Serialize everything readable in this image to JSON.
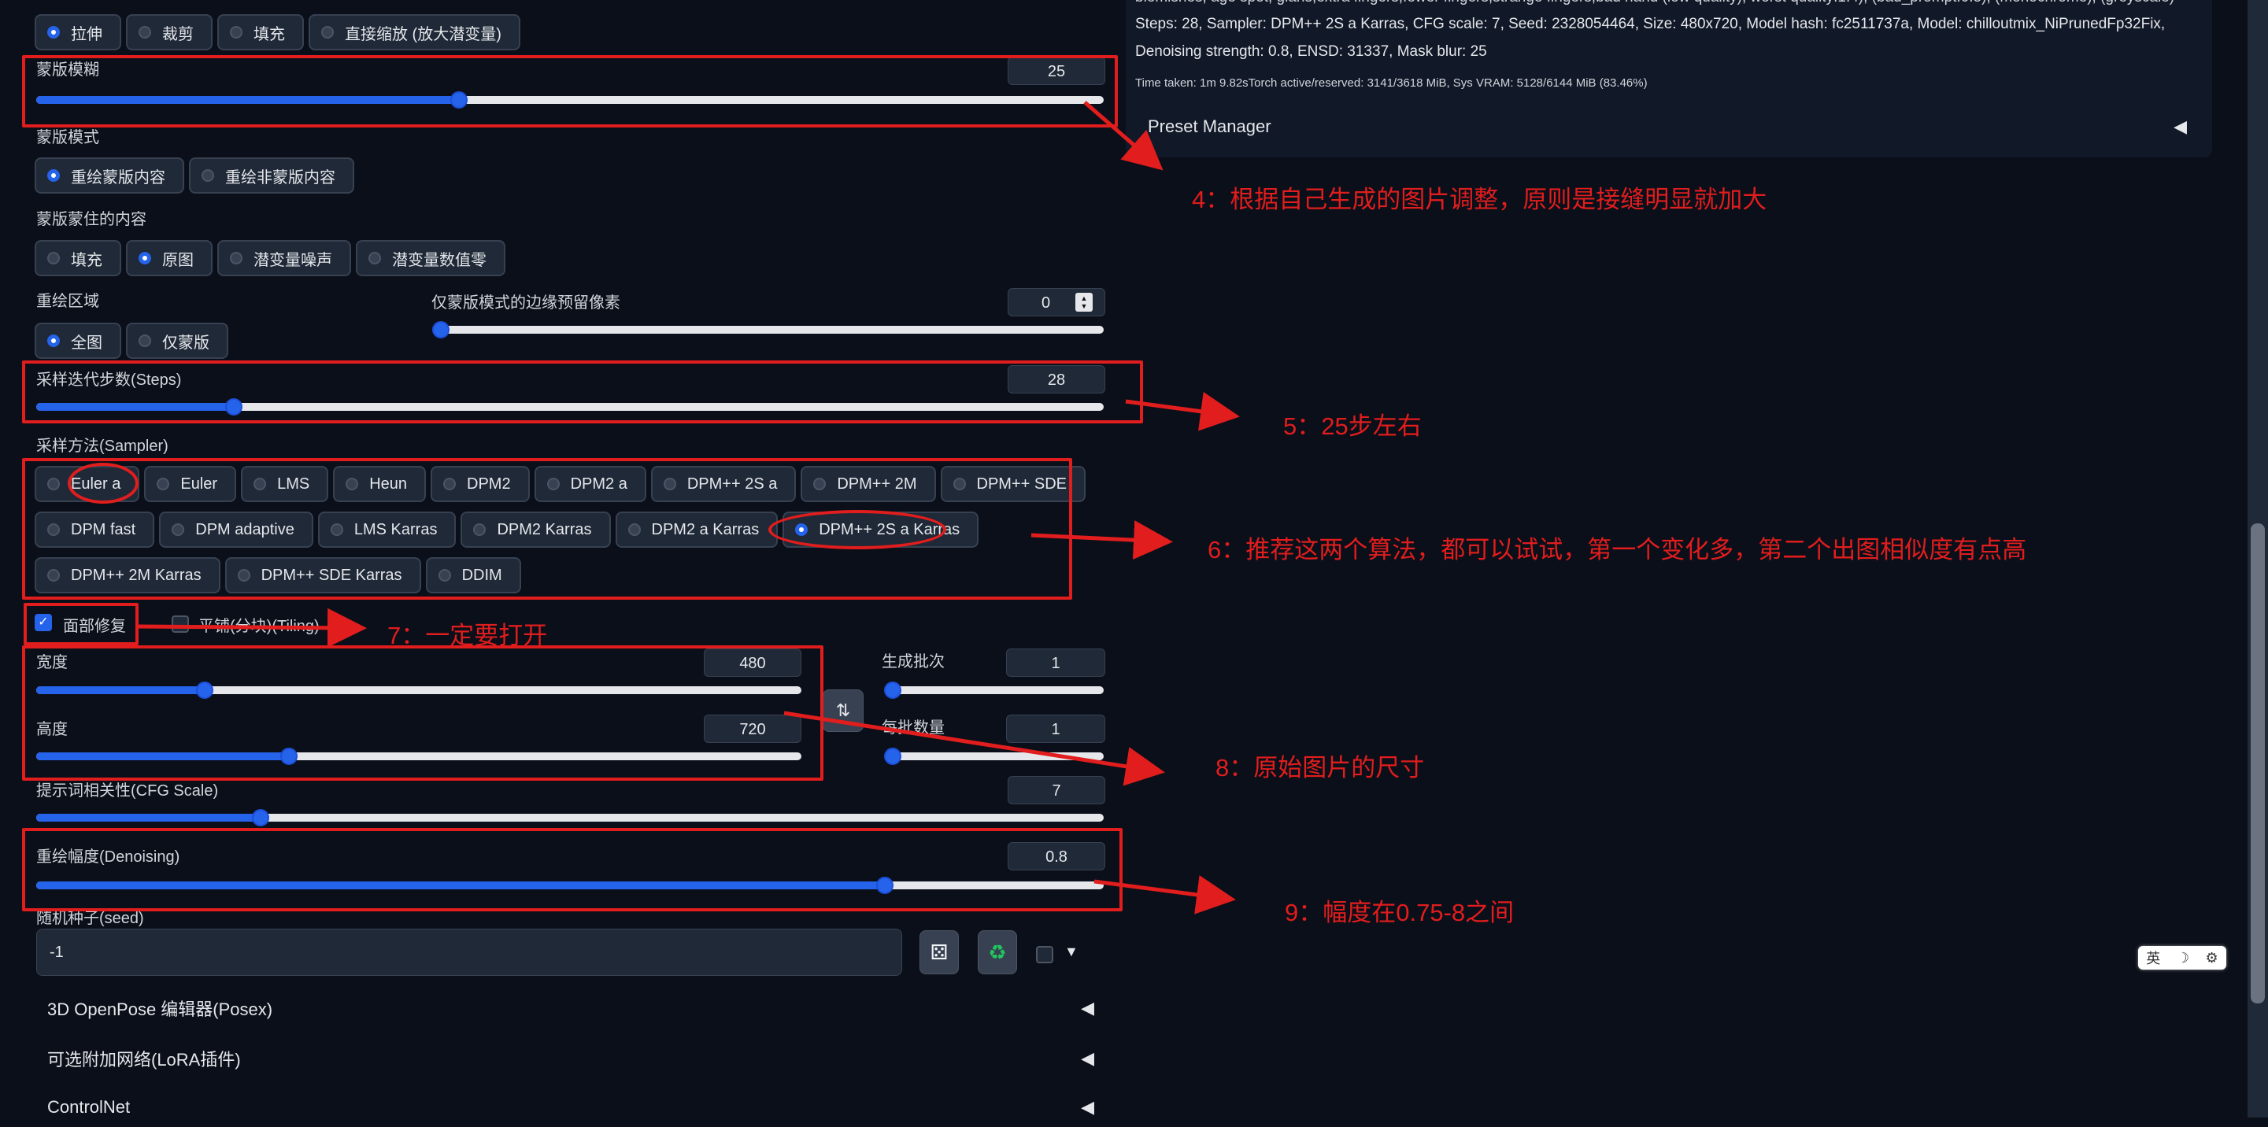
{
  "resize_modes": [
    "拉伸",
    "裁剪",
    "填充",
    "直接缩放 (放大潜变量)"
  ],
  "mask_blur": {
    "label": "蒙版模糊",
    "value": "25",
    "fraction": 0.396
  },
  "mask_mode": {
    "label": "蒙版模式",
    "options": [
      "重绘蒙版内容",
      "重绘非蒙版内容"
    ]
  },
  "masked_content": {
    "label": "蒙版蒙住的内容",
    "options": [
      "填充",
      "原图",
      "潜变量噪声",
      "潜变量数值零"
    ]
  },
  "inpaint_area": {
    "label": "重绘区域",
    "options": [
      "全图",
      "仅蒙版"
    ]
  },
  "padding": {
    "label": "仅蒙版模式的边缘预留像素",
    "value": "0",
    "fraction": 0.0
  },
  "steps": {
    "label": "采样迭代步数(Steps)",
    "value": "28",
    "fraction": 0.185
  },
  "sampler": {
    "label": "采样方法(Sampler)",
    "row1": [
      "Euler a",
      "Euler",
      "LMS",
      "Heun",
      "DPM2",
      "DPM2 a",
      "DPM++ 2S a",
      "DPM++ 2M",
      "DPM++ SDE"
    ],
    "row2": [
      "DPM fast",
      "DPM adaptive",
      "LMS Karras",
      "DPM2 Karras",
      "DPM2 a Karras",
      "DPM++ 2S a Karras"
    ],
    "row3": [
      "DPM++ 2M Karras",
      "DPM++ SDE Karras",
      "DDIM"
    ],
    "selected": "DPM++ 2S a Karras"
  },
  "restore_faces": {
    "label": "面部修复",
    "checked": true
  },
  "tiling": {
    "label": "平铺(分块)(Tiling)",
    "checked": false
  },
  "width": {
    "label": "宽度",
    "value": "480",
    "fraction": 0.22
  },
  "height": {
    "label": "高度",
    "value": "720",
    "fraction": 0.33
  },
  "batch_count": {
    "label": "生成批次",
    "value": "1",
    "fraction": 0.0
  },
  "batch_size": {
    "label": "每批数量",
    "value": "1",
    "fraction": 0.0
  },
  "cfg_scale": {
    "label": "提示词相关性(CFG Scale)",
    "value": "7",
    "fraction": 0.21
  },
  "denoising": {
    "label": "重绘幅度(Denoising)",
    "value": "0.8",
    "fraction": 0.795
  },
  "seed": {
    "label": "随机种子(seed)",
    "value": "-1"
  },
  "accordions": [
    "3D OpenPose 编辑器(Posex)",
    "可选附加网络(LoRA插件)",
    "ControlNet"
  ],
  "info": {
    "line0": "blemishes, age spot, glans,extra fingers,fewer fingers,strange fingers,bad hand (low quality), worst quality:1.4), (bad_prompt:0.8), (monochrome), (greyscale)",
    "line1": "Steps: 28, Sampler: DPM++ 2S a Karras, CFG scale: 7, Seed: 2328054464, Size: 480x720, Model hash: fc2511737a, Model: chilloutmix_NiPrunedFp32Fix,",
    "line2": "Denoising strength: 0.8, ENSD: 31337, Mask blur: 25",
    "time": "Time taken: 1m 9.82sTorch active/reserved: 3141/3618 MiB, Sys VRAM: 5128/6144 MiB (83.46%)"
  },
  "preset_manager": "Preset Manager",
  "annotations": {
    "a4": "4：根据自己生成的图片调整，原则是接缝明显就加大",
    "a5": "5：25步左右",
    "a6": "6：推荐这两个算法，都可以试试，第一个变化多，第二个出图相似度有点高",
    "a7": "7：一定要打开",
    "a8": "8：原始图片的尺寸",
    "a9": "9：幅度在0.75-8之间"
  },
  "ime": "英",
  "colors": {
    "accent": "#2563eb",
    "annotation": "#e11d1d",
    "background": "#0b0f19",
    "panel": "#1f2937"
  }
}
